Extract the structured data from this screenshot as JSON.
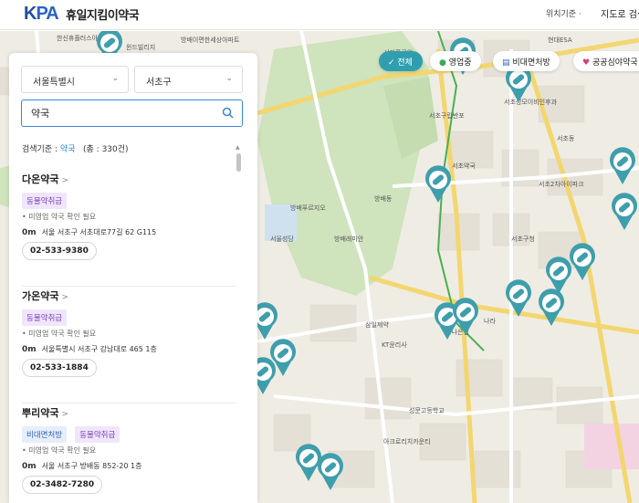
{
  "header": {
    "logo_main": "K",
    "logo_pa": "PA",
    "logo_sub": "휴일지킴이약국",
    "location_label": "위치기준 ·",
    "find_label": "지도로 검색"
  },
  "search": {
    "region_city": "서울특별시",
    "region_district": "서초구",
    "query": "약국",
    "criteria_prefix": "검색기준 : ",
    "criteria_keyword": "약국",
    "criteria_total": "(총 : 330건)"
  },
  "filters": {
    "all": "전체",
    "open": "영업중",
    "contact_free": "비대면처방",
    "public_night": "공공심야약국"
  },
  "pharmacies": [
    {
      "name": "다온약국",
      "badges": [
        "동물약취급"
      ],
      "status": "미영업  약국 확인 필요",
      "distance": "0m",
      "address": "서울 서초구 서초대로77길 62 G115",
      "phone": "02-533-9380"
    },
    {
      "name": "가온약국",
      "badges": [
        "동물약취급"
      ],
      "status": "미영업  약국 확인 필요",
      "distance": "0m",
      "address": "서울특별시 서초구 강남대로 465 1층",
      "phone": "02-533-1884"
    },
    {
      "name": "뿌리약국",
      "badges": [
        "비대면처방",
        "동물약취급"
      ],
      "status": "미영업  약국 확인 필요",
      "distance": "0m",
      "address": "서울 서초구 방배동 852-20 1층",
      "phone": "02-3482-7280"
    }
  ],
  "map_labels": [
    "한신휴플러스아파트",
    "윈드빌리지",
    "방배이편한세상아파트",
    "서리풀공원",
    "현대ESA",
    "서초성모이비인후과",
    "서초구립반포",
    "서초약국",
    "서초동",
    "하나은행",
    "삼일제약",
    "KT윤리사",
    "나라",
    "서초2차아이파크",
    "방배푸르지오",
    "서울성당",
    "방배래미안",
    "방배동",
    "성문고등학교",
    "아크로리치카운티",
    "서초구청"
  ],
  "colors": {
    "accent": "#2f9fb0",
    "brand": "#1e4fa0",
    "marker": "#3f9eac"
  }
}
